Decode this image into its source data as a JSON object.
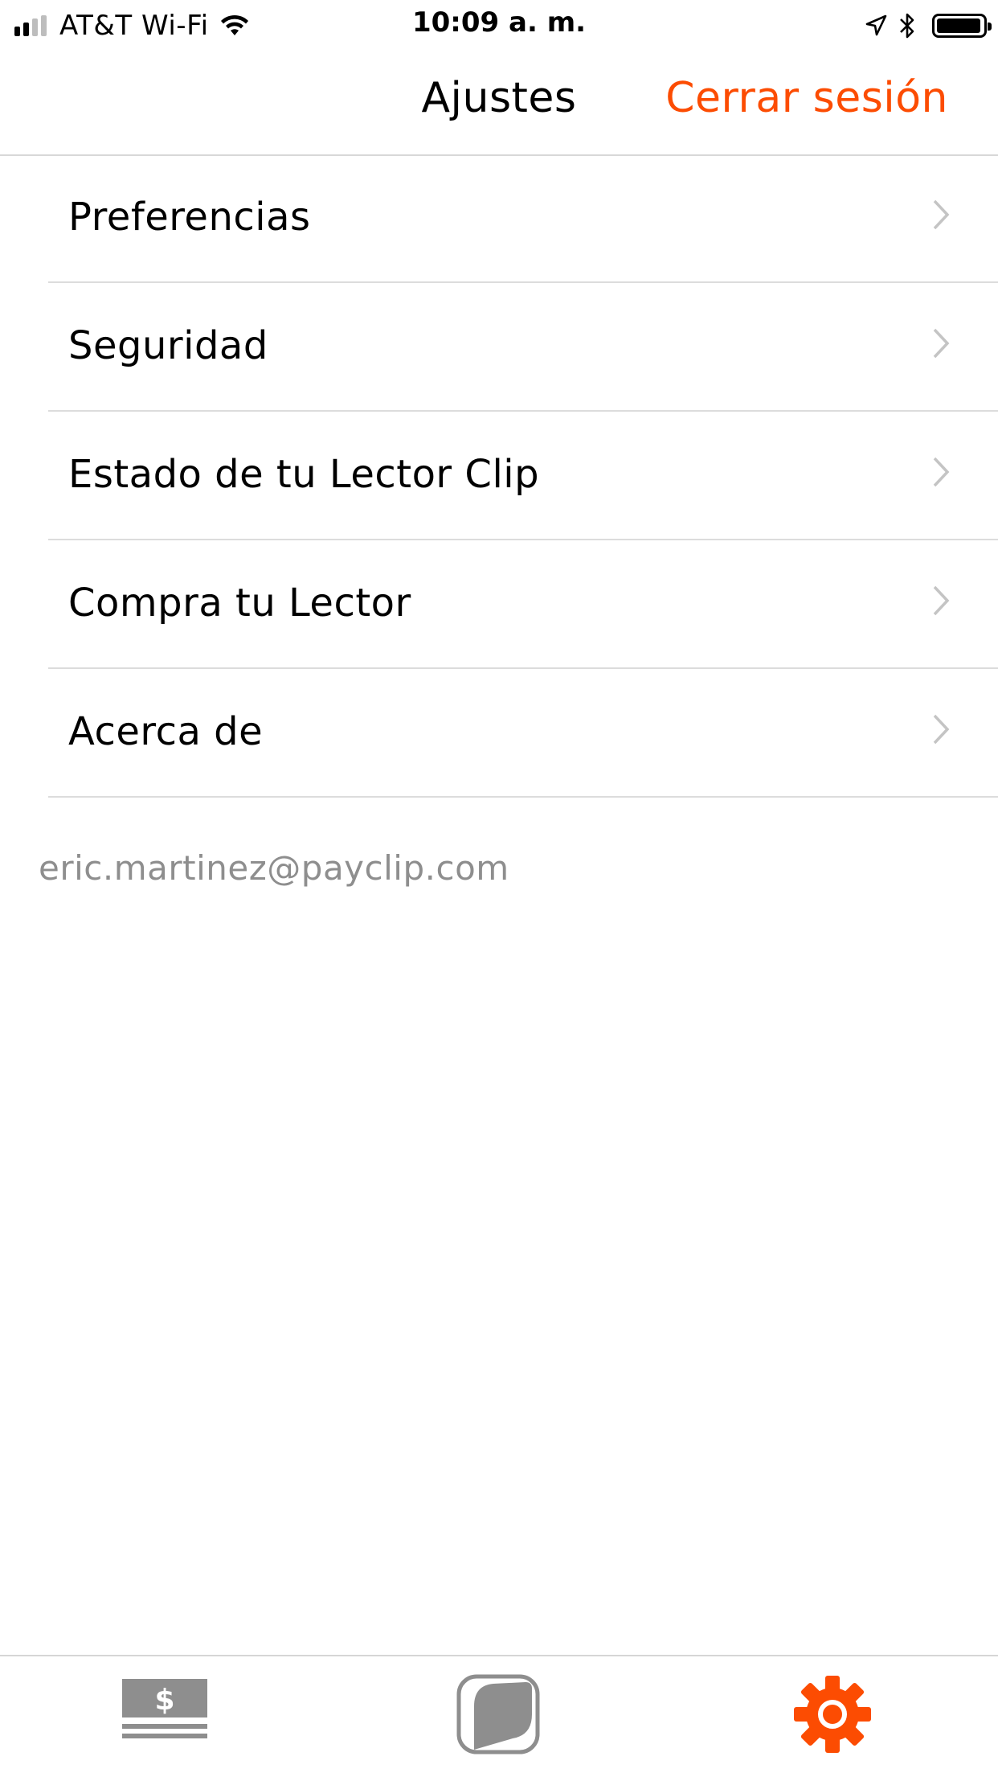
{
  "status_bar": {
    "carrier": "AT&T Wi-Fi",
    "time": "10:09 a. m.",
    "signal_bars_filled": 2,
    "signal_bars_total": 4
  },
  "nav": {
    "title": "Ajustes",
    "logout_label": "Cerrar sesión"
  },
  "menu": {
    "items": [
      {
        "label": "Preferencias"
      },
      {
        "label": "Seguridad"
      },
      {
        "label": "Estado de tu Lector Clip"
      },
      {
        "label": "Compra tu Lector"
      },
      {
        "label": "Acerca de"
      }
    ]
  },
  "account": {
    "email": "eric.martinez@payclip.com"
  },
  "tabs": {
    "items": [
      {
        "name": "sales",
        "icon": "cash-icon",
        "active": false
      },
      {
        "name": "reader",
        "icon": "card-reader-icon",
        "active": false
      },
      {
        "name": "settings",
        "icon": "gear-icon",
        "active": true
      }
    ]
  },
  "colors": {
    "accent": "#fc4c02",
    "inactive_icon": "#8e8e8e",
    "separator": "#dcdcdc",
    "secondary_text": "#8e8e8e"
  }
}
